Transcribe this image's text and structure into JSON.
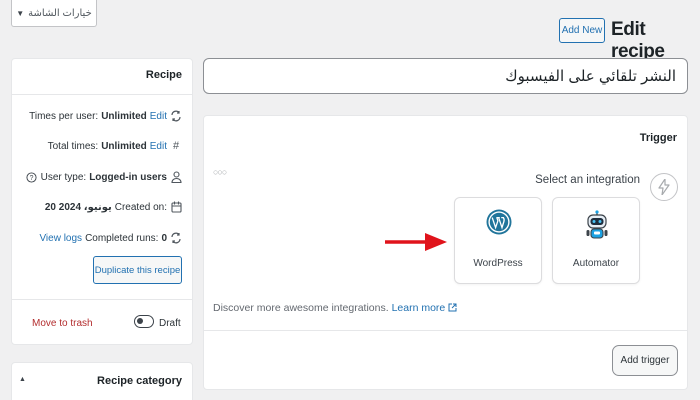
{
  "screen_options": {
    "label": "خيارات الشاشة"
  },
  "header": {
    "add_new": "Add New",
    "title": "Edit recipe"
  },
  "recipe_panel": {
    "title": "Recipe",
    "times_per_user": {
      "label": "Times per user:",
      "value": "Unlimited",
      "edit": "Edit"
    },
    "total_times": {
      "label": "Total times:",
      "value": "Unlimited",
      "edit": "Edit"
    },
    "user_type": {
      "label": "User type:",
      "value": "Logged-in users"
    },
    "created_on": {
      "label": "Created on:",
      "value": "20 يونيو، 2024"
    },
    "completed_runs": {
      "label": "Completed runs:",
      "value": "0",
      "view_logs": "View logs"
    },
    "duplicate_button": "Duplicate this recipe",
    "move_to_trash": "Move to trash",
    "status": "Draft"
  },
  "category_panel": {
    "title": "Recipe category"
  },
  "recipe_title_input": {
    "value": "النشر تلقائي على الفيسبوك"
  },
  "trigger": {
    "title": "Trigger",
    "select_integration": "Select an integration",
    "integrations": [
      {
        "name": "WordPress",
        "icon": "wordpress-logo"
      },
      {
        "name": "Automator",
        "icon": "automator-robot-logo"
      }
    ],
    "discover_text": "Discover more awesome integrations.",
    "learn_more": "Learn more",
    "add_trigger_button": "Add trigger"
  },
  "colors": {
    "accent": "#2271b1",
    "danger": "#b32d2e",
    "arrow": "#e0131b",
    "background": "#f0f0f1"
  }
}
